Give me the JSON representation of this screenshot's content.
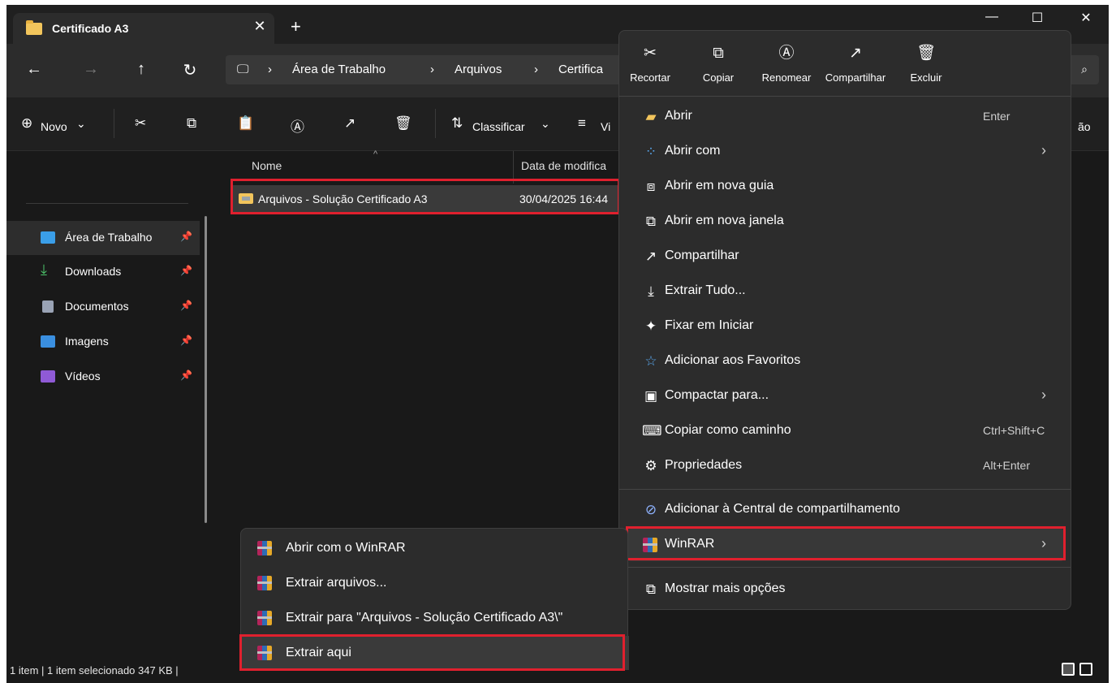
{
  "window": {
    "tab_title": "Certificado A3",
    "tab_close_glyph": "✕",
    "new_tab_glyph": "+",
    "minimize_glyph": "—",
    "maximize_glyph": "☐",
    "close_glyph": "✕"
  },
  "nav": {
    "back_glyph": "←",
    "forward_glyph": "→",
    "up_glyph": "↑",
    "refresh_glyph": "↻",
    "pc_glyph": "🖵",
    "sep": "›",
    "crumbs": [
      "Área de Trabalho",
      "Arquivos",
      "Certifica"
    ],
    "search_glyph": "⌕"
  },
  "toolbar": {
    "new_label": "Novo",
    "new_glyph": "⊕",
    "new_caret": "⌄",
    "cut_glyph": "✂",
    "copy_glyph": "⧉",
    "paste_glyph": "📋",
    "rename_glyph": "Ⓐ",
    "share_glyph": "↗",
    "delete_glyph": "🗑",
    "sort_label": "Classificar",
    "sort_glyph": "⇅",
    "sort_caret": "⌄",
    "view_label": "Vi",
    "view_glyph": "≡",
    "right_cut_label": "ão"
  },
  "sidebar": {
    "items": [
      {
        "label": "Área de Trabalho",
        "pin": "📌",
        "icon": "desktop-icon",
        "color": "#3a9ee8"
      },
      {
        "label": "Downloads",
        "pin": "📌",
        "icon": "download-icon",
        "color": "#4cc46a"
      },
      {
        "label": "Documentos",
        "pin": "📌",
        "icon": "document-icon",
        "color": "#9aa3b5"
      },
      {
        "label": "Imagens",
        "pin": "📌",
        "icon": "image-icon",
        "color": "#3a8fe0"
      },
      {
        "label": "Vídeos",
        "pin": "📌",
        "icon": "video-icon",
        "color": "#8f5ad6"
      }
    ]
  },
  "columns": {
    "name": "Nome",
    "date": "Data de modifica",
    "sort_glyph": "^"
  },
  "files": [
    {
      "name": "Arquivos - Solução Certificado A3",
      "date": "30/04/2025 16:44"
    }
  ],
  "status": {
    "text": "1 item  |  1 item selecionado  347 KB  |"
  },
  "context_menu": {
    "quick_actions": [
      {
        "label": "Recortar",
        "glyph": "✂"
      },
      {
        "label": "Copiar",
        "glyph": "⧉"
      },
      {
        "label": "Renomear",
        "glyph": "Ⓐ"
      },
      {
        "label": "Compartilhar",
        "glyph": "↗"
      },
      {
        "label": "Excluir",
        "glyph": "🗑"
      }
    ],
    "items": [
      {
        "label": "Abrir",
        "shortcut": "Enter",
        "glyph": "▰"
      },
      {
        "label": "Abrir com",
        "arrow": "›",
        "glyph": "⁘"
      },
      {
        "label": "Abrir em nova guia",
        "glyph": "⧈"
      },
      {
        "label": "Abrir em nova janela",
        "glyph": "⧉"
      },
      {
        "label": "Compartilhar",
        "glyph": "↗"
      },
      {
        "label": "Extrair Tudo...",
        "glyph": "⤓"
      },
      {
        "label": "Fixar em Iniciar",
        "glyph": "✦"
      },
      {
        "label": "Adicionar aos Favoritos",
        "glyph": "☆"
      },
      {
        "label": "Compactar para...",
        "arrow": "›",
        "glyph": "▣"
      },
      {
        "label": "Copiar como caminho",
        "shortcut": "Ctrl+Shift+C",
        "glyph": "⌨"
      },
      {
        "label": "Propriedades",
        "shortcut": "Alt+Enter",
        "glyph": "⚙"
      },
      {
        "label": "Adicionar à Central de compartilhamento",
        "glyph": "⊘"
      },
      {
        "label": "WinRAR",
        "arrow": "›"
      },
      {
        "label": "Mostrar mais opções",
        "glyph": "⧉"
      }
    ]
  },
  "submenu": {
    "items": [
      {
        "label": "Abrir com o WinRAR"
      },
      {
        "label": "Extrair arquivos..."
      },
      {
        "label": "Extrair para \"Arquivos - Solução Certificado A3\\\""
      },
      {
        "label": "Extrair aqui"
      }
    ]
  },
  "colors": {
    "highlight": "#e0202e",
    "background": "#191919",
    "menu": "#2c2c2c"
  }
}
